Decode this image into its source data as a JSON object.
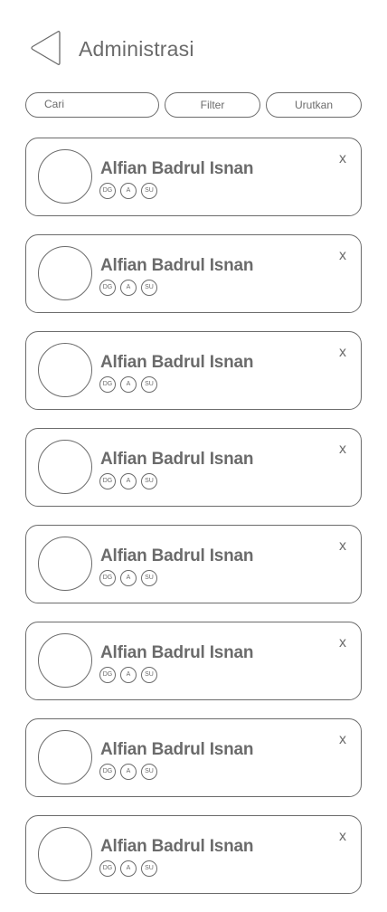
{
  "header": {
    "title": "Administrasi",
    "back_icon": "back-triangle-icon"
  },
  "controls": {
    "search_placeholder": "Cari",
    "filter_label": "Filter",
    "sort_label": "Urutkan"
  },
  "colors": {
    "stroke": "#6b6b6b",
    "background": "#ffffff"
  },
  "members": [
    {
      "name": "Alfian Badrul Isnan",
      "badges": [
        "DG",
        "A",
        "SU"
      ],
      "remove_label": "x"
    },
    {
      "name": "Alfian Badrul Isnan",
      "badges": [
        "DG",
        "A",
        "SU"
      ],
      "remove_label": "x"
    },
    {
      "name": "Alfian Badrul Isnan",
      "badges": [
        "DG",
        "A",
        "SU"
      ],
      "remove_label": "x"
    },
    {
      "name": "Alfian Badrul Isnan",
      "badges": [
        "DG",
        "A",
        "SU"
      ],
      "remove_label": "x"
    },
    {
      "name": "Alfian Badrul Isnan",
      "badges": [
        "DG",
        "A",
        "SU"
      ],
      "remove_label": "x"
    },
    {
      "name": "Alfian Badrul Isnan",
      "badges": [
        "DG",
        "A",
        "SU"
      ],
      "remove_label": "x"
    },
    {
      "name": "Alfian Badrul Isnan",
      "badges": [
        "DG",
        "A",
        "SU"
      ],
      "remove_label": "x"
    },
    {
      "name": "Alfian Badrul Isnan",
      "badges": [
        "DG",
        "A",
        "SU"
      ],
      "remove_label": "x"
    }
  ]
}
